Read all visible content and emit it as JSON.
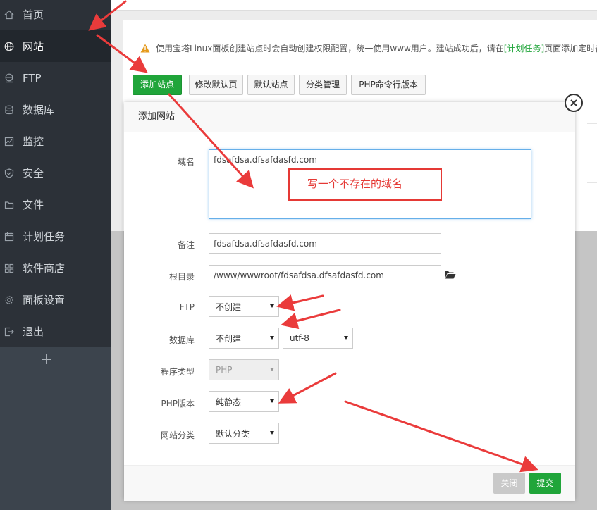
{
  "sidebar": {
    "items": [
      {
        "label": "首页",
        "icon": "home-icon",
        "active": false
      },
      {
        "label": "网站",
        "icon": "globe-icon",
        "active": true
      },
      {
        "label": "FTP",
        "icon": "ftp-icon",
        "active": false
      },
      {
        "label": "数据库",
        "icon": "database-icon",
        "active": false
      },
      {
        "label": "监控",
        "icon": "monitor-icon",
        "active": false
      },
      {
        "label": "安全",
        "icon": "shield-icon",
        "active": false
      },
      {
        "label": "文件",
        "icon": "folder-icon",
        "active": false
      },
      {
        "label": "计划任务",
        "icon": "calendar-icon",
        "active": false
      },
      {
        "label": "软件商店",
        "icon": "grid-icon",
        "active": false
      },
      {
        "label": "面板设置",
        "icon": "gear-icon",
        "active": false
      },
      {
        "label": "退出",
        "icon": "logout-icon",
        "active": false
      }
    ],
    "add_label": "+"
  },
  "notice": {
    "text_before": "使用宝塔Linux面板创建站点时会自动创建权限配置，统一使用www用户。建站成功后，请在",
    "link": "[计划任务]",
    "text_after": "页面添加定时备"
  },
  "toolbar": {
    "add_site": "添加站点",
    "modify_default_page": "修改默认页",
    "default_site": "默认站点",
    "category_manage": "分类管理",
    "php_cli_version": "PHP命令行版本"
  },
  "modal": {
    "title": "添加网站",
    "domain_label": "域名",
    "domain_value": "fdsafdsa.dfsafdasfd.com",
    "remark_label": "备注",
    "remark_value": "fdsafdsa.dfsafdasfd.com",
    "root_label": "根目录",
    "root_value": "/www/wwwroot/fdsafdsa.dfsafdasfd.com",
    "ftp_label": "FTP",
    "ftp_value": "不创建",
    "db_label": "数据库",
    "db_value": "不创建",
    "db_charset": "utf-8",
    "program_label": "程序类型",
    "program_value": "PHP",
    "php_label": "PHP版本",
    "php_value": "纯静态",
    "category_label": "网站分类",
    "category_value": "默认分类",
    "close_label": "关闭",
    "submit_label": "提交"
  },
  "annotation": {
    "text": "写一个不存在的域名"
  },
  "colors": {
    "accent_green": "#20a53a",
    "sidebar_bg": "#2c3138",
    "annotation_red": "#e53935"
  }
}
